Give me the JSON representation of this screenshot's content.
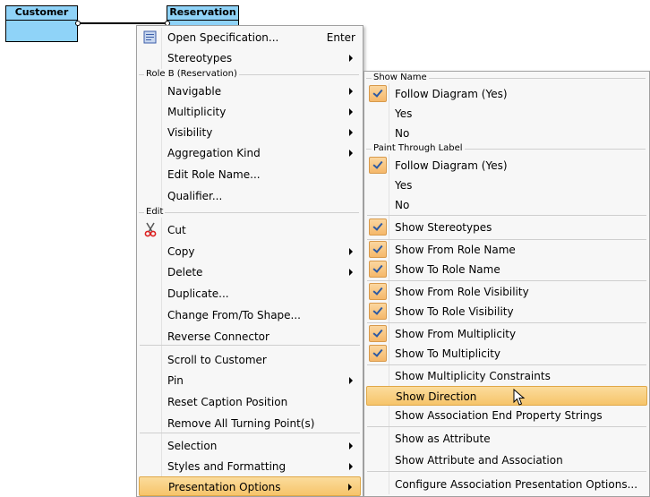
{
  "diagram": {
    "classes": [
      {
        "name": "Customer"
      },
      {
        "name": "Reservation"
      }
    ]
  },
  "context_menu": {
    "open_spec": {
      "label": "Open Specification...",
      "shortcut": "Enter"
    },
    "stereotypes": "Stereotypes",
    "role_b_section": "Role B (Reservation)",
    "navigable": "Navigable",
    "multiplicity": "Multiplicity",
    "visibility": "Visibility",
    "aggregation_kind": "Aggregation Kind",
    "edit_role_name": "Edit Role Name...",
    "qualifier": "Qualifier...",
    "edit_section": "Edit",
    "cut": "Cut",
    "copy": "Copy",
    "delete": "Delete",
    "duplicate": "Duplicate...",
    "change_shape": "Change From/To Shape...",
    "reverse_connector": "Reverse Connector",
    "scroll_to": "Scroll to Customer",
    "pin": "Pin",
    "reset_caption": "Reset Caption Position",
    "remove_turning": "Remove All Turning Point(s)",
    "selection": "Selection",
    "styles": "Styles and Formatting",
    "presentation_options": "Presentation Options"
  },
  "submenu": {
    "show_name_section": "Show Name",
    "show_name_follow": "Follow Diagram (Yes)",
    "show_name_yes": "Yes",
    "show_name_no": "No",
    "paint_section": "Paint Through Label",
    "paint_follow": "Follow Diagram (Yes)",
    "paint_yes": "Yes",
    "paint_no": "No",
    "show_stereotypes": "Show Stereotypes",
    "show_from_role_name": "Show From Role Name",
    "show_to_role_name": "Show To Role Name",
    "show_from_role_visibility": "Show From Role Visibility",
    "show_to_role_visibility": "Show To Role Visibility",
    "show_from_multiplicity": "Show From Multiplicity",
    "show_to_multiplicity": "Show To Multiplicity",
    "show_multiplicity_constraints": "Show Multiplicity Constraints",
    "show_direction": "Show Direction",
    "show_end_property_strings": "Show Association End Property Strings",
    "show_as_attribute": "Show as Attribute",
    "show_attr_and_assoc": "Show Attribute and Association",
    "configure": "Configure Association Presentation Options..."
  }
}
